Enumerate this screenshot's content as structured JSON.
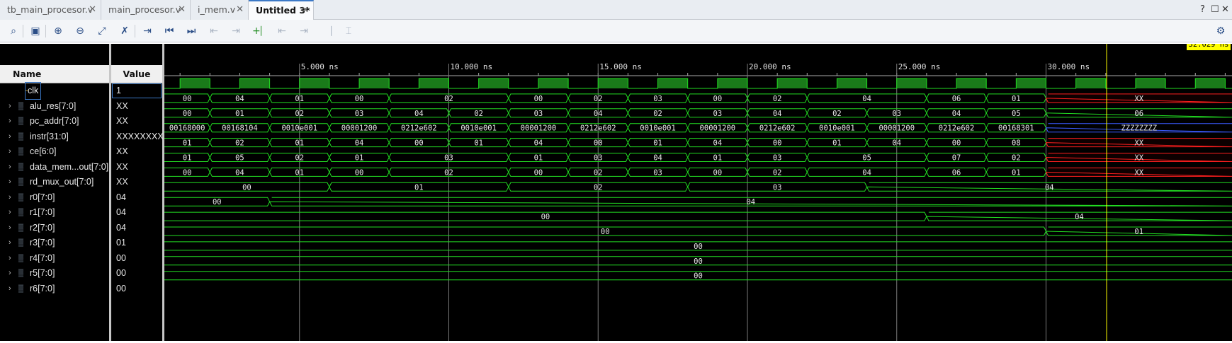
{
  "tabs": [
    {
      "label": "tb_main_procesor.v",
      "active": false
    },
    {
      "label": "main_procesor.v",
      "active": false
    },
    {
      "label": "i_mem.v",
      "active": false
    },
    {
      "label": "Untitled 3*",
      "active": true
    }
  ],
  "window_controls": {
    "help": "?",
    "restore": "☐",
    "close": "✕"
  },
  "toolbar_icons": [
    "search-icon",
    "save-icon",
    "zoom-in-icon",
    "zoom-out-icon",
    "zoom-fit-icon",
    "cursor-swap-icon",
    "goto-cursor-icon",
    "goto-start-icon",
    "goto-end-icon",
    "prev-transition-icon",
    "next-transition-icon",
    "add-marker-icon",
    "prev-marker-icon",
    "next-marker-icon",
    "swap-cursors-icon",
    "snap-icon",
    "settings-icon"
  ],
  "columns": {
    "name": "Name",
    "value": "Value"
  },
  "cursor": {
    "label": "32.029 ns",
    "time": 32.029
  },
  "timeline": {
    "ticks": [
      "5.000 ns",
      "10.000 ns",
      "15.000 ns",
      "20.000 ns",
      "25.000 ns",
      "30.000 ns"
    ],
    "tick_times": [
      5,
      10,
      15,
      20,
      25,
      30
    ]
  },
  "signals": [
    {
      "name": "clk",
      "value": "1",
      "type": "bit",
      "expandable": false
    },
    {
      "name": "alu_res[7:0]",
      "value": "XX",
      "type": "bus",
      "expandable": true,
      "segments": [
        "00",
        "04",
        "01",
        "00",
        "02",
        "00",
        "02",
        "03",
        "00",
        "02",
        "04",
        "06",
        "01",
        "XX"
      ],
      "starts": [
        0,
        2,
        4,
        6,
        8,
        12,
        14,
        16,
        18,
        20,
        22,
        26,
        28,
        30
      ]
    },
    {
      "name": "pc_addr[7:0]",
      "value": "XX",
      "type": "bus",
      "expandable": true,
      "segments": [
        "00",
        "01",
        "02",
        "03",
        "04",
        "02",
        "03",
        "04",
        "02",
        "03",
        "04",
        "02",
        "03",
        "04",
        "05",
        "06"
      ],
      "starts": [
        0,
        2,
        4,
        6,
        8,
        10,
        12,
        14,
        16,
        18,
        20,
        22,
        24,
        26,
        28,
        30
      ]
    },
    {
      "name": "instr[31:0]",
      "value": "XXXXXXXX",
      "type": "bus",
      "expandable": true,
      "segments": [
        "00168000",
        "00168104",
        "0010e001",
        "00001200",
        "0212e602",
        "0010e001",
        "00001200",
        "0212e602",
        "0010e001",
        "00001200",
        "0212e602",
        "0010e001",
        "00001200",
        "0212e602",
        "00168301",
        "ZZZZZZZZ"
      ],
      "starts": [
        0,
        2,
        4,
        6,
        8,
        10,
        12,
        14,
        16,
        18,
        20,
        22,
        24,
        26,
        28,
        30
      ]
    },
    {
      "name": "ce[6:0]",
      "value": "XX",
      "type": "bus",
      "expandable": true,
      "segments": [
        "01",
        "02",
        "01",
        "04",
        "00",
        "01",
        "04",
        "00",
        "01",
        "04",
        "00",
        "01",
        "04",
        "00",
        "08",
        "XX"
      ],
      "starts": [
        0,
        2,
        4,
        6,
        8,
        10,
        12,
        14,
        16,
        18,
        20,
        22,
        24,
        26,
        28,
        30
      ]
    },
    {
      "name": "data_mem...out[7:0]",
      "value": "XX",
      "type": "bus",
      "expandable": true,
      "segments": [
        "01",
        "05",
        "02",
        "01",
        "03",
        "01",
        "03",
        "04",
        "01",
        "03",
        "05",
        "07",
        "02",
        "XX"
      ],
      "starts": [
        0,
        2,
        4,
        6,
        8,
        12,
        14,
        16,
        18,
        20,
        22,
        26,
        28,
        30
      ]
    },
    {
      "name": "rd_mux_out[7:0]",
      "value": "XX",
      "type": "bus",
      "expandable": true,
      "segments": [
        "00",
        "04",
        "01",
        "00",
        "02",
        "00",
        "02",
        "03",
        "00",
        "02",
        "04",
        "06",
        "01",
        "XX"
      ],
      "starts": [
        0,
        2,
        4,
        6,
        8,
        12,
        14,
        16,
        18,
        20,
        22,
        26,
        28,
        30
      ]
    },
    {
      "name": "r0[7:0]",
      "value": "04",
      "type": "bus",
      "expandable": true,
      "segments": [
        "00",
        "01",
        "02",
        "03",
        "04"
      ],
      "starts": [
        0,
        6,
        12,
        18,
        24
      ]
    },
    {
      "name": "r1[7:0]",
      "value": "04",
      "type": "bus",
      "expandable": true,
      "segments": [
        "00",
        "04"
      ],
      "starts": [
        0,
        4
      ]
    },
    {
      "name": "r2[7:0]",
      "value": "04",
      "type": "bus",
      "expandable": true,
      "segments": [
        "00",
        "04"
      ],
      "starts": [
        0,
        26
      ]
    },
    {
      "name": "r3[7:0]",
      "value": "01",
      "type": "bus",
      "expandable": true,
      "segments": [
        "00",
        "01"
      ],
      "starts": [
        0,
        30
      ]
    },
    {
      "name": "r4[7:0]",
      "value": "00",
      "type": "bus",
      "expandable": true,
      "segments": [
        "00"
      ],
      "starts": [
        0
      ]
    },
    {
      "name": "r5[7:0]",
      "value": "00",
      "type": "bus",
      "expandable": true,
      "segments": [
        "00"
      ],
      "starts": [
        0
      ]
    },
    {
      "name": "r6[7:0]",
      "value": "00",
      "type": "bus",
      "expandable": true,
      "segments": [
        "00"
      ],
      "starts": [
        0
      ]
    }
  ],
  "colors": {
    "wave": "#22dd22",
    "clock_fill": "#1a7a1a",
    "x_state": "#ff2020",
    "z_state": "#3b5bff",
    "cursor": "#ffff00",
    "grid": "#7a7a7a"
  }
}
